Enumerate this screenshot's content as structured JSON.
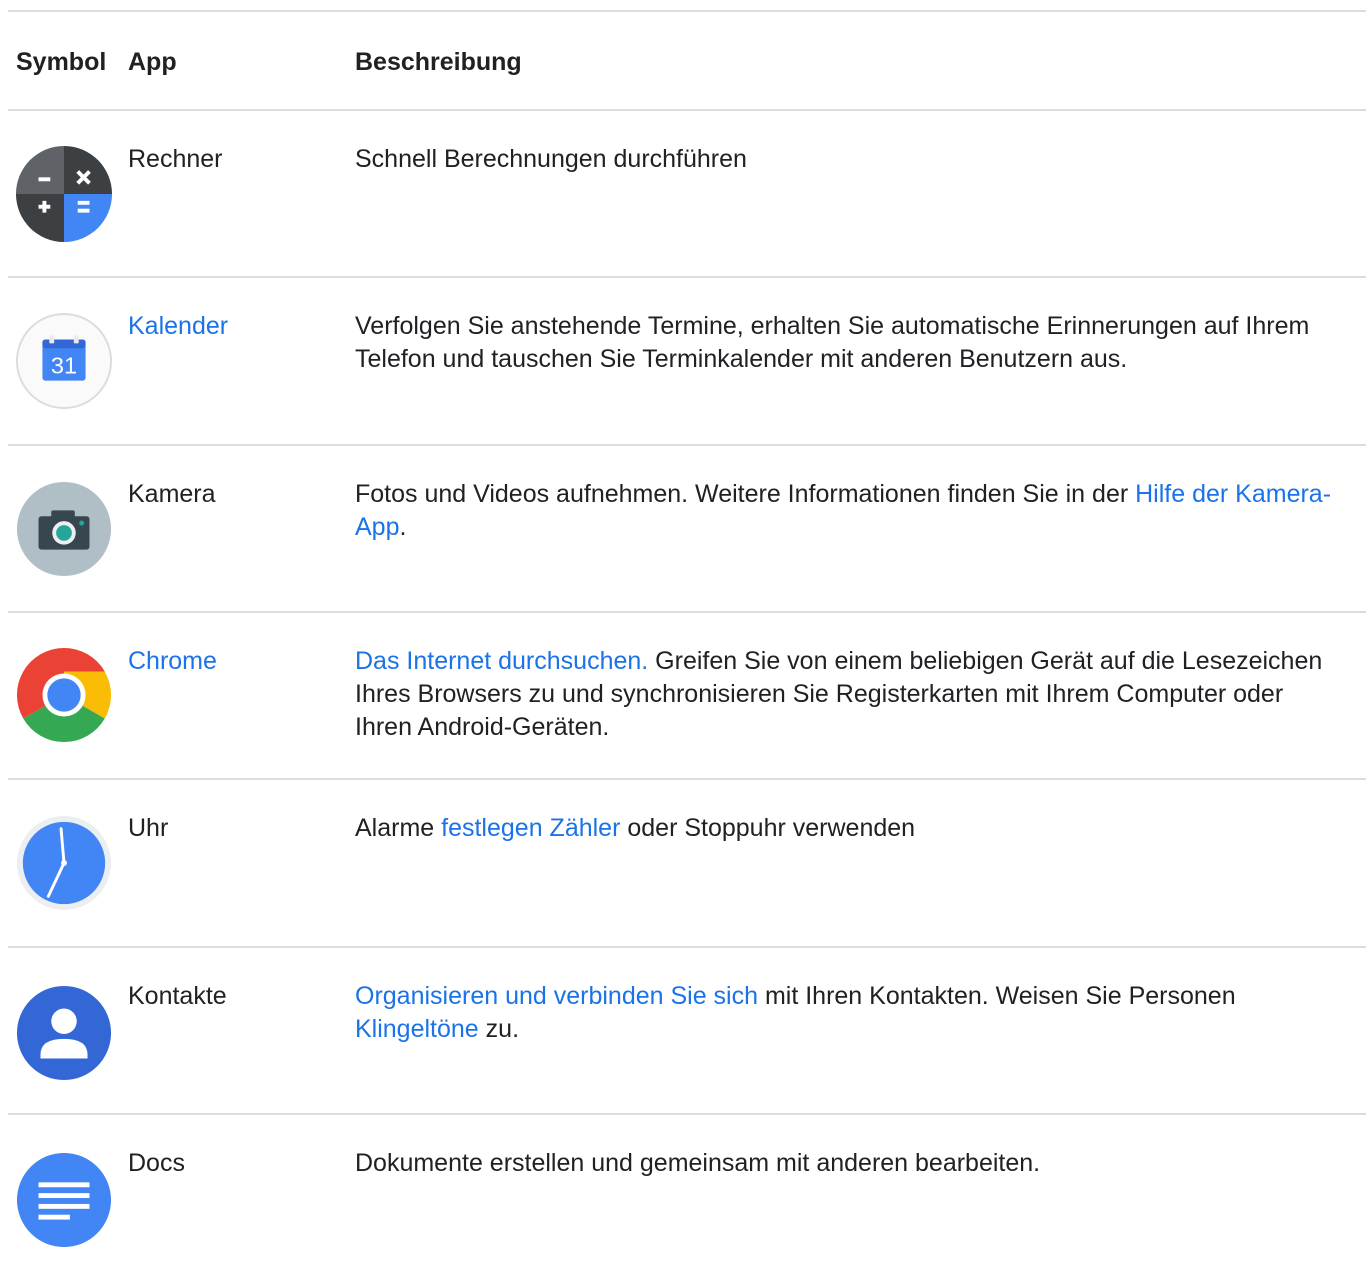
{
  "header": {
    "symbol": "Symbol",
    "app": "App",
    "description": "Beschreibung"
  },
  "rows": [
    {
      "app": "Rechner",
      "icon": "calculator-icon",
      "desc": [
        "Schnell Berechnungen durchführen"
      ]
    },
    {
      "app": "Kalender",
      "icon": "calendar-icon",
      "calendar_day": "31",
      "desc": [
        "Verfolgen Sie anstehende Termine, erhalten Sie automatische Erinnerungen auf Ihrem Telefon und tauschen Sie Terminkalender mit anderen Benutzern aus."
      ]
    },
    {
      "app": "Kamera",
      "icon": "camera-icon",
      "desc": [
        "Fotos und Videos aufnehmen. Weitere Informationen finden Sie in der ",
        "Hilfe der Kamera-App",
        "."
      ]
    },
    {
      "app": "Chrome",
      "icon": "chrome-icon",
      "desc": [
        "Das Internet durchsuchen.",
        " Greifen Sie von einem beliebigen Gerät auf die Lesezeichen Ihres Browsers zu und synchronisieren Sie Registerkarten mit Ihrem Computer oder Ihren Android-Geräten."
      ]
    },
    {
      "app": "Uhr",
      "icon": "clock-icon",
      "desc": [
        "Alarme ",
        "festlegen Zähler",
        " oder Stoppuhr verwenden"
      ]
    },
    {
      "app": "Kontakte",
      "icon": "contacts-icon",
      "desc": [
        "Organisieren und verbinden Sie sich",
        " mit Ihren Kontakten. Weisen Sie Personen ",
        "Klingeltöne",
        " zu."
      ]
    },
    {
      "app": "Docs",
      "icon": "docs-icon",
      "desc": [
        "Dokumente erstellen und gemeinsam mit anderen bearbeiten."
      ]
    }
  ],
  "colors": {
    "link": "#1a73e8",
    "divider": "#dadce0",
    "text": "#202124"
  }
}
